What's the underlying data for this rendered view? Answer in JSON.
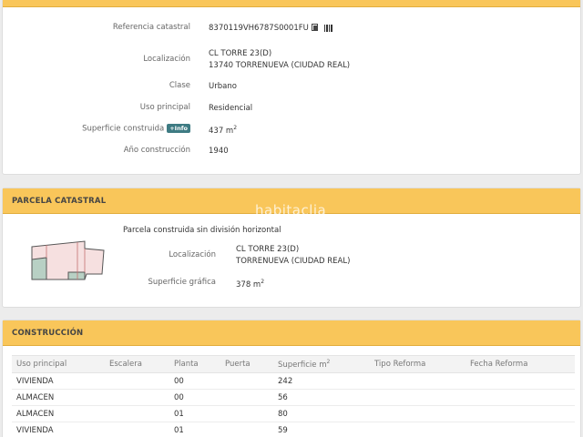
{
  "referencia": {
    "rows": {
      "ref": {
        "label": "Referencia catastral",
        "value": "8370119VH6787S0001FU"
      },
      "loc": {
        "label": "Localización",
        "line1": "CL TORRE 23(D)",
        "line2": "13740 TORRENUEVA (CIUDAD REAL)"
      },
      "clase": {
        "label": "Clase",
        "value": "Urbano"
      },
      "uso": {
        "label": "Uso principal",
        "value": "Residencial"
      },
      "sup": {
        "label": "Superficie construida",
        "badge": "+Info",
        "value": "437 m",
        "unit_exp": "2"
      },
      "anio": {
        "label": "Año construcción",
        "value": "1940"
      }
    },
    "icons": [
      "copy-icon",
      "barcode-icon"
    ]
  },
  "parcela": {
    "title": "PARCELA CATASTRAL",
    "watermark": "habitaclia",
    "description": "Parcela construida sin división horizontal",
    "loc": {
      "label": "Localización",
      "line1": "CL TORRE 23(D)",
      "line2": "TORRENUEVA (CIUDAD REAL)"
    },
    "sup": {
      "label": "Superficie gráfica",
      "value": "378 m",
      "unit_exp": "2"
    }
  },
  "construccion": {
    "title": "CONSTRUCCIÓN",
    "headers": {
      "uso": "Uso principal",
      "escalera": "Escalera",
      "planta": "Planta",
      "puerta": "Puerta",
      "superficie": "Superficie m",
      "superficie_exp": "2",
      "tipo": "Tipo Reforma",
      "fecha": "Fecha Reforma"
    },
    "rows": [
      {
        "uso": "VIVIENDA",
        "escalera": "",
        "planta": "00",
        "puerta": "",
        "superficie": "242",
        "tipo": "",
        "fecha": ""
      },
      {
        "uso": "ALMACEN",
        "escalera": "",
        "planta": "00",
        "puerta": "",
        "superficie": "56",
        "tipo": "",
        "fecha": ""
      },
      {
        "uso": "ALMACEN",
        "escalera": "",
        "planta": "01",
        "puerta": "",
        "superficie": "80",
        "tipo": "",
        "fecha": ""
      },
      {
        "uso": "VIVIENDA",
        "escalera": "",
        "planta": "01",
        "puerta": "",
        "superficie": "59",
        "tipo": "",
        "fecha": ""
      }
    ]
  },
  "colors": {
    "accent": "#f9c65a",
    "badge": "#3e7b83",
    "parcel_fill": "#f6e0e0",
    "parcel_building": "#b8d0c4"
  }
}
